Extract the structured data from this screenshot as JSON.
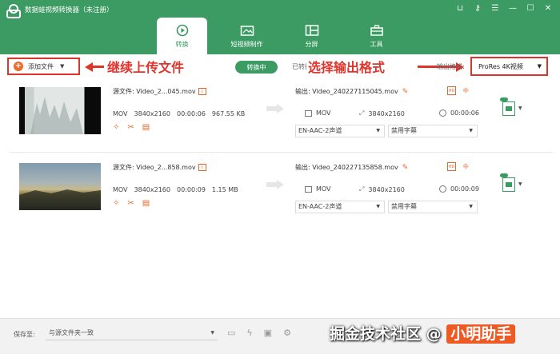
{
  "app": {
    "title": "数据蛙视频转换器（未注册）"
  },
  "window_controls": [
    "cart-icon",
    "key-icon",
    "menu-icon",
    "minimize-icon",
    "maximize-icon",
    "close-icon"
  ],
  "tabs": [
    {
      "label": "转换",
      "icon": "convert-icon",
      "active": true
    },
    {
      "label": "短视频制作",
      "icon": "short-video-icon",
      "active": false
    },
    {
      "label": "分屏",
      "icon": "split-screen-icon",
      "active": false
    },
    {
      "label": "工具",
      "icon": "toolbox-icon",
      "active": false
    }
  ],
  "toolbar": {
    "add_file_label": "添加文件",
    "converting_label": "转换中",
    "done_label": "已转换",
    "output_format_label": "输出格式:",
    "output_format_value": "ProRes 4K视频"
  },
  "annotations": {
    "continue_upload": "继续上传文件",
    "select_format": "选择输出格式"
  },
  "files": [
    {
      "source_label": "源文件: Video_2...045.mov",
      "format": "MOV",
      "resolution": "3840x2160",
      "duration": "00:00:06",
      "size": "967.55 KB",
      "output_label": "输出: Video_240227115045.mov",
      "out_format": "MOV",
      "out_resolution": "3840x2160",
      "out_duration": "00:00:06",
      "audio": "EN-AAC-2声道",
      "subtitle": "禁用字幕"
    },
    {
      "source_label": "源文件: Video_2...858.mov",
      "format": "MOV",
      "resolution": "3840x2160",
      "duration": "00:00:09",
      "size": "1.15 MB",
      "output_label": "输出: Video_240227135858.mov",
      "out_format": "MOV",
      "out_resolution": "3840x2160",
      "out_duration": "00:00:09",
      "audio": "EN-AAC-2声道",
      "subtitle": "禁用字幕"
    }
  ],
  "footer": {
    "save_label": "保存至:",
    "save_path": "与源文件夹一致"
  },
  "watermark": {
    "text": "掘金技术社区 @",
    "author": "小明助手"
  },
  "colors": {
    "brand": "#3c9a63",
    "annotation": "#e0342b",
    "accent": "#e06a2b"
  }
}
